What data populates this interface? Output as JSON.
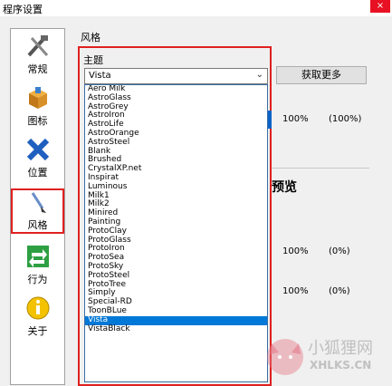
{
  "window": {
    "title": "程序设置",
    "close_glyph": "×"
  },
  "sidebar": {
    "items": [
      {
        "label": "常规",
        "icon": "tools-icon"
      },
      {
        "label": "图标",
        "icon": "box-icon"
      },
      {
        "label": "位置",
        "icon": "move-icon"
      },
      {
        "label": "风格",
        "icon": "brush-icon",
        "selected": true
      },
      {
        "label": "行为",
        "icon": "arrow-icon"
      },
      {
        "label": "关于",
        "icon": "info-icon"
      }
    ]
  },
  "style_panel": {
    "group_label": "风格",
    "theme_label": "主题",
    "theme_selected": "Vista",
    "get_more_label": "获取更多",
    "themes": [
      "Aero Milk",
      "AstroGlass",
      "AstroGrey",
      "AstroIron",
      "AstroLife",
      "AstroOrange",
      "AstroSteel",
      "Blank",
      "Brushed",
      "CrystalXP.net",
      "Inspirat",
      "Luminous",
      "Milk1",
      "Milk2",
      "Minired",
      "Painting",
      "ProtoClay",
      "ProtoGlass",
      "ProtoIron",
      "ProtoSea",
      "ProtoSky",
      "ProtoSteel",
      "ProtoTree",
      "Simply",
      "Special-RD",
      "ToonBLue",
      "Vista",
      "VistaBlack"
    ],
    "row1": {
      "value": "100%",
      "range": "(100%)"
    },
    "preview_label": "预览",
    "row2": {
      "value": "100%",
      "range": "(0%)"
    },
    "row3": {
      "value": "100%",
      "range": "(0%)"
    }
  },
  "watermark": {
    "cn": "小狐狸网",
    "en": "XHLKS.CN"
  }
}
